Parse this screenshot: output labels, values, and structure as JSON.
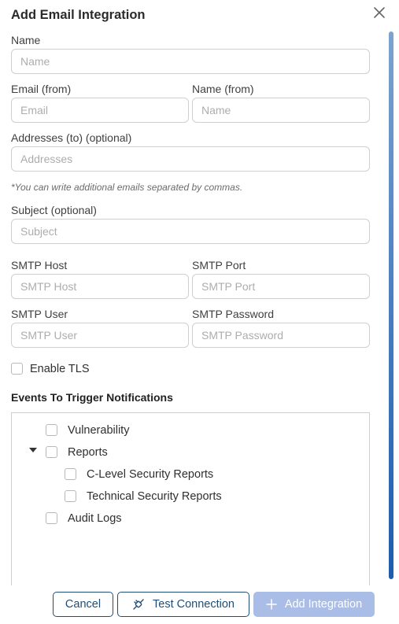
{
  "dialog": {
    "title": "Add Email Integration"
  },
  "form": {
    "name": {
      "label": "Name",
      "placeholder": "Name",
      "value": ""
    },
    "email_from": {
      "label": "Email (from)",
      "placeholder": "Email",
      "value": ""
    },
    "name_from": {
      "label": "Name (from)",
      "placeholder": "Name",
      "value": ""
    },
    "addresses_to": {
      "label": "Addresses (to) (optional)",
      "placeholder": "Addresses",
      "value": ""
    },
    "addresses_note": "*You can write additional emails separated by commas.",
    "subject": {
      "label": "Subject (optional)",
      "placeholder": "Subject",
      "value": ""
    },
    "smtp_host": {
      "label": "SMTP Host",
      "placeholder": "SMTP Host",
      "value": ""
    },
    "smtp_port": {
      "label": "SMTP Port",
      "placeholder": "SMTP Port",
      "value": ""
    },
    "smtp_user": {
      "label": "SMTP User",
      "placeholder": "SMTP User",
      "value": ""
    },
    "smtp_password": {
      "label": "SMTP Password",
      "placeholder": "SMTP Password",
      "value": ""
    },
    "enable_tls": {
      "label": "Enable TLS",
      "checked": false
    }
  },
  "events": {
    "title": "Events To Trigger Notifications",
    "items": [
      {
        "label": "Vulnerability",
        "checked": false
      },
      {
        "label": "Reports",
        "checked": false,
        "expanded": true,
        "children": [
          {
            "label": "C-Level Security Reports",
            "checked": false
          },
          {
            "label": "Technical Security Reports",
            "checked": false
          }
        ]
      },
      {
        "label": "Audit Logs",
        "checked": false
      }
    ]
  },
  "footer": {
    "cancel_label": "Cancel",
    "test_label": "Test Connection",
    "add_label": "Add Integration"
  },
  "colors": {
    "primary": "#1f4e79",
    "disabled_button": "#a9bde6",
    "scrollbar": "#2a66b3"
  },
  "icons": {
    "close": "close-icon",
    "test": "plug-icon",
    "add": "plus-icon",
    "expand": "caret-down-icon"
  }
}
